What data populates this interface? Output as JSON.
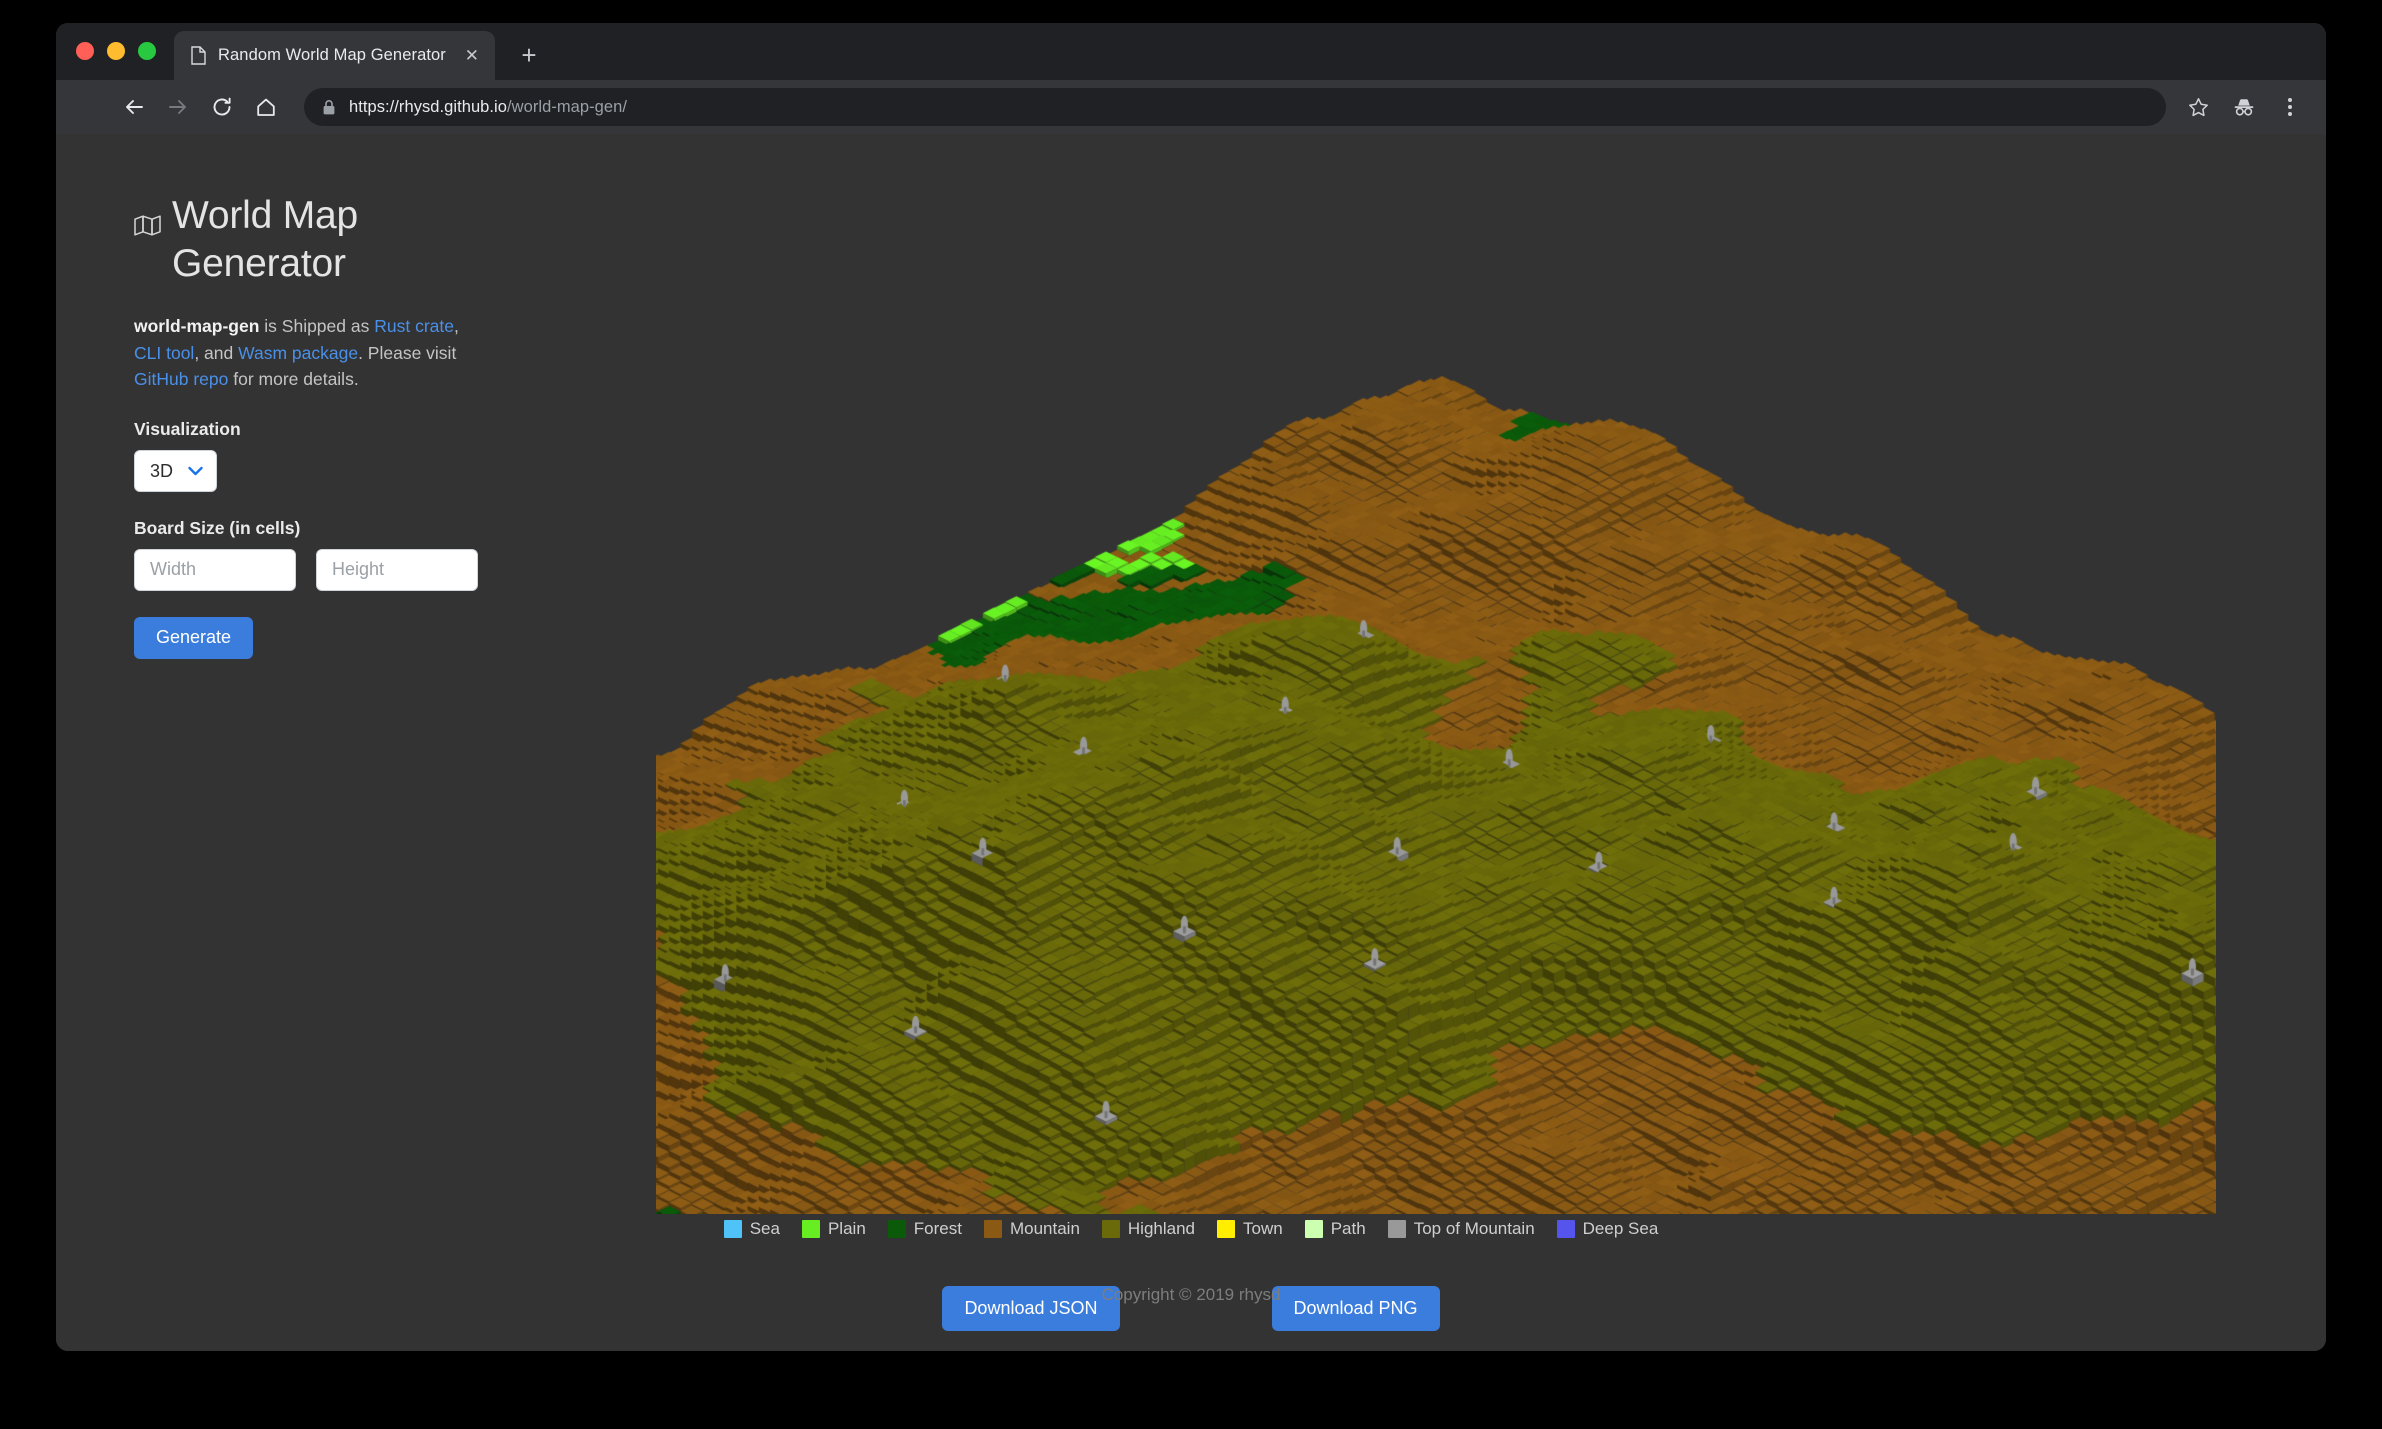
{
  "browser": {
    "tab": {
      "title": "Random World Map Generator",
      "favicon_icon": "page-icon",
      "close_icon": "close-icon"
    },
    "new_tab_icon": "plus-icon",
    "nav": {
      "back_icon": "arrow-back-icon",
      "forward_icon": "arrow-forward-icon",
      "reload_icon": "reload-icon",
      "home_icon": "home-icon"
    },
    "omnibox": {
      "lock_icon": "lock-icon",
      "url_scheme_host": "https://rhysd.github.io",
      "url_path": "/world-map-gen/"
    },
    "toolbar_right": {
      "bookmark_icon": "star-icon",
      "incognito_icon": "incognito-icon",
      "menu_icon": "three-dot-menu-icon"
    }
  },
  "sidebar": {
    "title_icon": "map-icon",
    "title": "World Map Generator",
    "intro": {
      "brand": "world-map-gen",
      "text_1": " is Shipped as ",
      "link_rust": "Rust crate",
      "text_2": ", ",
      "link_cli": "CLI tool",
      "text_3": ", and ",
      "link_wasm": "Wasm package",
      "text_4": ". Please visit ",
      "link_repo": "GitHub repo",
      "text_5": " for more details."
    },
    "visualization": {
      "label": "Visualization",
      "selected": "3D",
      "options": [
        "3D"
      ],
      "chevron_icon": "chevron-down-icon",
      "chevron_color": "#1a73e8"
    },
    "board_size": {
      "label": "Board Size (in cells)",
      "width_value": "",
      "width_placeholder": "Width",
      "height_value": "",
      "height_placeholder": "Height"
    },
    "generate_label": "Generate"
  },
  "legend": [
    {
      "label": "Sea",
      "color": "#4fc3f7"
    },
    {
      "label": "Plain",
      "color": "#66ee22"
    },
    {
      "label": "Forest",
      "color": "#0a5a0a"
    },
    {
      "label": "Mountain",
      "color": "#8a5a14"
    },
    {
      "label": "Highland",
      "color": "#6a6a0a"
    },
    {
      "label": "Town",
      "color": "#ffee00"
    },
    {
      "label": "Path",
      "color": "#ccffb0"
    },
    {
      "label": "Top of Mountain",
      "color": "#999999"
    },
    {
      "label": "Deep Sea",
      "color": "#5555ee"
    }
  ],
  "downloads": {
    "json_label": "Download JSON",
    "png_label": "Download PNG",
    "button_color": "#3b7ddd"
  },
  "footer": {
    "copyright": "Copyright © 2019 rhysd"
  },
  "map": {
    "render_type": "isometric-voxel-terrain",
    "grid_cells": 128,
    "background": "#333333",
    "terrain_colors": {
      "sea": "#4fc3f7",
      "plain": "#66ee22",
      "forest": "#0a5a0a",
      "mountain": "#8a5a14",
      "highland": "#6a6a0a",
      "town": "#ffee00",
      "path": "#ccffb0",
      "top_of_mountain": "#999999",
      "deep_sea": "#5555ee"
    }
  }
}
